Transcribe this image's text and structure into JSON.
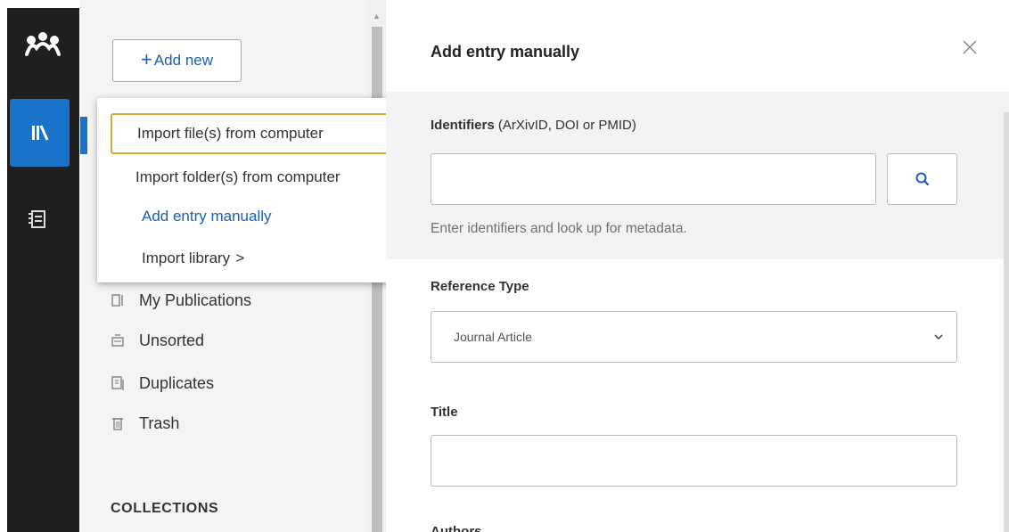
{
  "rail": {
    "logo_icon": "mendeley-logo",
    "items": [
      {
        "icon": "library-icon",
        "active": true
      },
      {
        "icon": "notebook-icon",
        "active": false
      }
    ]
  },
  "sidebar": {
    "add_new_label": "Add new",
    "add_new_plus": "+",
    "nav": [
      {
        "label": "My Publications",
        "icon": "publications-icon"
      },
      {
        "label": "Unsorted",
        "icon": "unsorted-icon"
      },
      {
        "label": "Duplicates",
        "icon": "duplicates-icon"
      },
      {
        "label": "Trash",
        "icon": "trash-icon"
      }
    ],
    "collections_heading": "COLLECTIONS"
  },
  "menu": {
    "items": [
      {
        "label": "Import file(s) from computer",
        "focused": true
      },
      {
        "label": "Import folder(s) from computer"
      },
      {
        "label": "Add entry manually",
        "link": true
      },
      {
        "label": "Import library",
        "suffix": ">"
      }
    ]
  },
  "panel": {
    "title": "Add entry manually",
    "identifiers_label": "Identifiers",
    "identifiers_hint_paren": "(ArXivID, DOI or PMID)",
    "identifiers_value": "",
    "lookup_hint": "Enter identifiers and look up for metadata.",
    "reference_type_label": "Reference Type",
    "reference_type_value": "Journal Article",
    "title_label": "Title",
    "title_value": "",
    "authors_label": "Authors"
  },
  "colors": {
    "rail_bg": "#1f1f1f",
    "accent": "#1a73c9",
    "link": "#1a5fb4",
    "focus_ring": "#e2a33b"
  }
}
